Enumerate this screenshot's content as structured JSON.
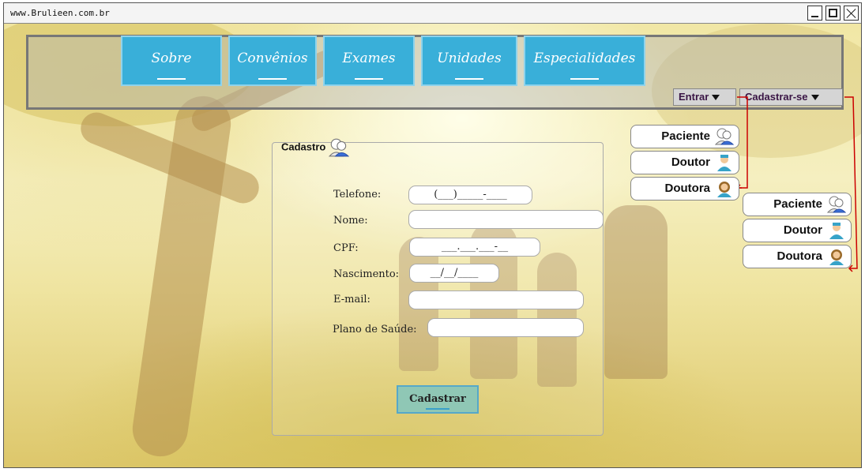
{
  "browser": {
    "url": "www.Brulieen.com.br"
  },
  "nav": {
    "tabs": [
      {
        "label": "Sobre"
      },
      {
        "label": "Convênios"
      },
      {
        "label": "Exames"
      },
      {
        "label": "Unidades"
      },
      {
        "label": "Especialidades"
      }
    ]
  },
  "auth": {
    "login_label": "Entrar",
    "signup_label": "Cadastrar-se"
  },
  "menu_login": {
    "items": [
      {
        "label": "Paciente",
        "icon": "patient-icon"
      },
      {
        "label": "Doutor",
        "icon": "doctor-icon"
      },
      {
        "label": "Doutora",
        "icon": "female-doctor-icon"
      }
    ]
  },
  "menu_signup": {
    "items": [
      {
        "label": "Paciente",
        "icon": "patient-icon"
      },
      {
        "label": "Doutor",
        "icon": "doctor-icon"
      },
      {
        "label": "Doutora",
        "icon": "female-doctor-icon"
      }
    ]
  },
  "form": {
    "title": "Cadastro",
    "fields": {
      "telefone": {
        "label": "Telefone:",
        "value": "(___)_____-____"
      },
      "nome": {
        "label": "Nome:",
        "value": ""
      },
      "cpf": {
        "label": "CPF:",
        "value": "___.___.___-__"
      },
      "nascimento": {
        "label": "Nascimento:",
        "value": "__/__/____"
      },
      "email": {
        "label": "E-mail:",
        "value": ""
      },
      "plano": {
        "label": "Plano de Saúde:",
        "value": ""
      }
    },
    "submit_label": "Cadastrar"
  },
  "colors": {
    "tab": "#39afd9",
    "connector": "#cc0000",
    "submit": "#8fc7b5"
  }
}
